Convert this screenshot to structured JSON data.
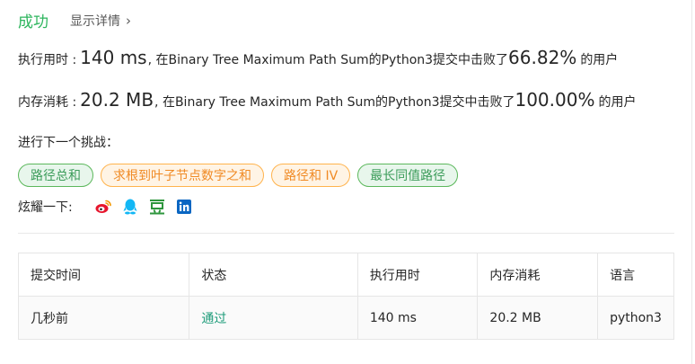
{
  "result": {
    "status": "成功",
    "show_details": "显示详情"
  },
  "runtime": {
    "label": "执行用时 :",
    "value": "140 ms",
    "suffix_text": ", 在Binary Tree Maximum Path Sum的Python3提交中击败了",
    "percent": "66.82%",
    "users": "的用户"
  },
  "memory": {
    "label": "内存消耗 :",
    "value": "20.2 MB",
    "suffix_text": ", 在Binary Tree Maximum Path Sum的Python3提交中击败了",
    "percent": "100.00%",
    "users": "的用户"
  },
  "challenge": {
    "label": "进行下一个挑战：",
    "tags": [
      {
        "label": "路径总和",
        "color": "green"
      },
      {
        "label": "求根到叶子节点数字之和",
        "color": "orange"
      },
      {
        "label": "路径和 IV",
        "color": "orange"
      },
      {
        "label": "最长同值路径",
        "color": "green"
      }
    ]
  },
  "share": {
    "label": "炫耀一下:",
    "icons": [
      "weibo-icon",
      "qq-icon",
      "douban-icon",
      "linkedin-icon"
    ]
  },
  "table": {
    "headers": [
      "提交时间",
      "状态",
      "执行用时",
      "内存消耗",
      "语言"
    ],
    "rows": [
      [
        "几秒前",
        "通过",
        "140 ms",
        "20.2 MB",
        "python3"
      ]
    ]
  },
  "colors": {
    "success": "#2db55d",
    "accepted": "#1e9c7a",
    "tag_green": "#3c9c5a",
    "tag_orange": "#f08a24",
    "weibo": "#e6162d",
    "qq": "#12b7f5",
    "douban": "#2e963d",
    "linkedin": "#0a66c2"
  }
}
